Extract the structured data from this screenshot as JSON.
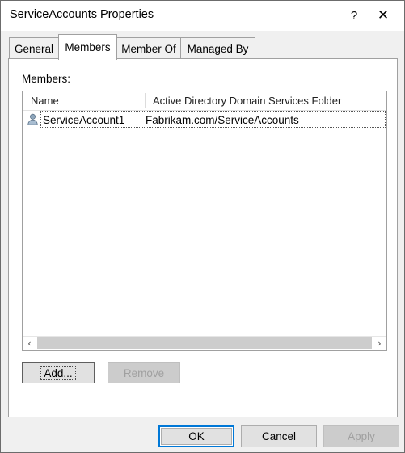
{
  "window": {
    "title": "ServiceAccounts Properties",
    "help_glyph": "?",
    "close_glyph": "✕"
  },
  "tabs": [
    {
      "label": "General",
      "selected": false
    },
    {
      "label": "Members",
      "selected": true
    },
    {
      "label": "Member Of",
      "selected": false
    },
    {
      "label": "Managed By",
      "selected": false
    }
  ],
  "page": {
    "members_label": "Members:",
    "columns": [
      "Name",
      "Active Directory Domain Services Folder"
    ],
    "rows": [
      {
        "name": "ServiceAccount1",
        "folder": "Fabrikam.com/ServiceAccounts"
      }
    ],
    "scroll": {
      "left_arrow": "‹",
      "right_arrow": "›"
    },
    "buttons": {
      "add": "Add...",
      "remove": "Remove"
    }
  },
  "footer": {
    "ok": "OK",
    "cancel": "Cancel",
    "apply": "Apply"
  },
  "colors": {
    "accent": "#0078d7",
    "window_bg": "#f0f0f0",
    "page_bg": "#ffffff",
    "button_face": "#e1e1e1",
    "disabled_face": "#cccccc",
    "disabled_text": "#a0a0a0",
    "scroll_thumb": "#cdcdcd"
  }
}
